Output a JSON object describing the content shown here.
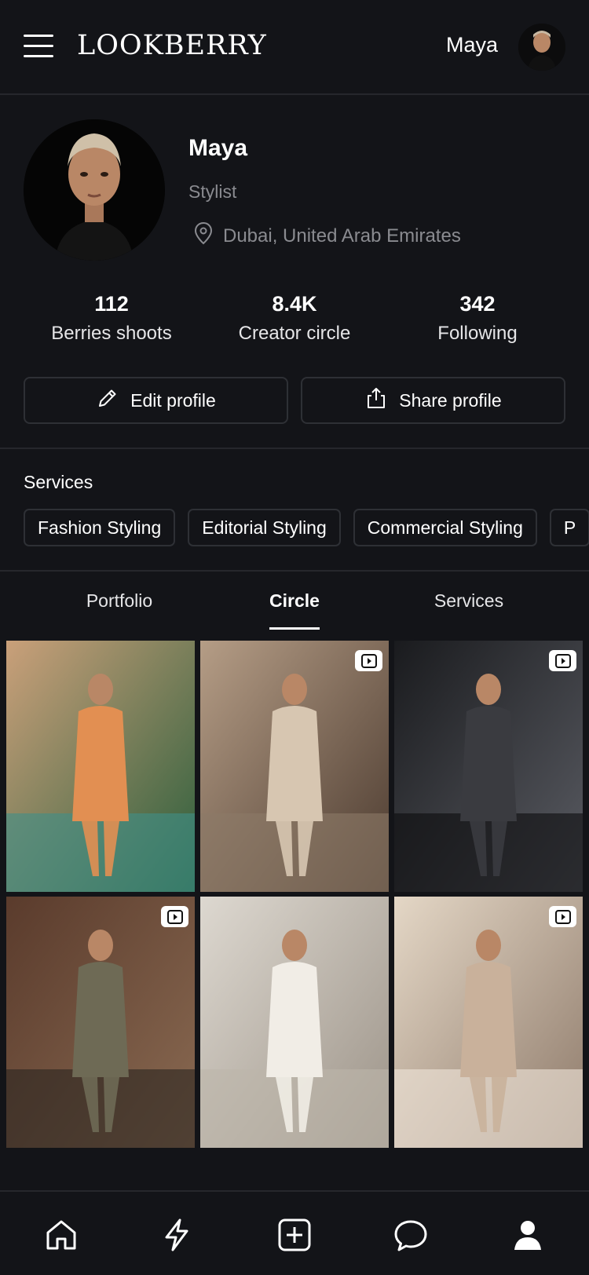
{
  "header": {
    "brand": "LOOKBERRY",
    "user_name": "Maya"
  },
  "profile": {
    "name": "Maya",
    "role": "Stylist",
    "location": "Dubai, United Arab Emirates"
  },
  "stats": [
    {
      "value": "112",
      "label": "Berries shoots"
    },
    {
      "value": "8.4K",
      "label": "Creator circle"
    },
    {
      "value": "342",
      "label": "Following"
    }
  ],
  "actions": {
    "edit_label": "Edit profile",
    "share_label": "Share profile"
  },
  "services": {
    "title": "Services",
    "chips": [
      "Fashion Styling",
      "Editorial Styling",
      "Commercial Styling",
      "P"
    ]
  },
  "tabs": {
    "items": [
      "Portfolio",
      "Circle",
      "Services"
    ],
    "active": "Circle"
  },
  "grid": {
    "items": [
      {
        "has_video": false,
        "palette": [
          "#caa07a",
          "#e28f52",
          "#3f8f89",
          "#2b5e3b"
        ]
      },
      {
        "has_video": true,
        "palette": [
          "#b59d86",
          "#d7c6b1",
          "#8c7a68",
          "#4b3a2f"
        ]
      },
      {
        "has_video": true,
        "palette": [
          "#1a1b1e",
          "#3a3b40",
          "#0c0c0d",
          "#5a5c63"
        ]
      },
      {
        "has_video": true,
        "palette": [
          "#5a3b2c",
          "#6e6a55",
          "#2a241f",
          "#8a6a52"
        ]
      },
      {
        "has_video": false,
        "palette": [
          "#ddd8d0",
          "#f1ede6",
          "#bdb5aa",
          "#9c9388"
        ]
      },
      {
        "has_video": true,
        "palette": [
          "#e4d7c6",
          "#c9b19b",
          "#f0e6da",
          "#8e7a6a"
        ]
      }
    ]
  },
  "bottom_nav": [
    "home-icon",
    "lightning-icon",
    "add-icon",
    "chat-icon",
    "profile-icon"
  ],
  "colors": {
    "background": "#131418",
    "border": "#2e3035",
    "muted_text": "#8a8b90"
  }
}
